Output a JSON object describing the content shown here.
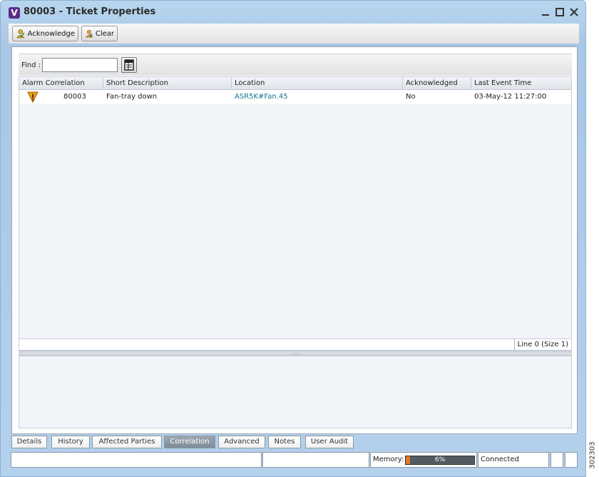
{
  "window": {
    "badge": "V",
    "title": "80003 - Ticket Properties"
  },
  "toolbar": {
    "acknowledge_label": "Acknowledge",
    "clear_label": "Clear"
  },
  "find": {
    "label": "Find :",
    "value": ""
  },
  "table": {
    "columns": [
      "Alarm Correlation",
      "Short Description",
      "Location",
      "Acknowledged",
      "Last Event Time"
    ],
    "rows": [
      {
        "severity_icon": "warning-icon",
        "alarm_id": "80003",
        "short_description": "Fan-tray down",
        "location": "ASR5K#Fan.45",
        "acknowledged": "No",
        "last_event_time": "03-May-12 11:27:00"
      }
    ]
  },
  "line_info": "Line 0 (Size 1)",
  "tabs": [
    {
      "label": "Details",
      "active": false
    },
    {
      "label": "History",
      "active": false
    },
    {
      "label": "Affected Parties",
      "active": false
    },
    {
      "label": "Correlation",
      "active": true
    },
    {
      "label": "Advanced",
      "active": false
    },
    {
      "label": "Notes",
      "active": false
    },
    {
      "label": "User Audit",
      "active": false
    }
  ],
  "statusbar": {
    "memory_label": "Memory:",
    "memory_percent": 6,
    "memory_text": "6%",
    "connection": "Connected"
  },
  "figure_id": "302303",
  "colors": {
    "memory_fill": "#e07a2a",
    "active_tab": "#8a96a3",
    "link": "#11768a",
    "warning": "#f0a020"
  }
}
